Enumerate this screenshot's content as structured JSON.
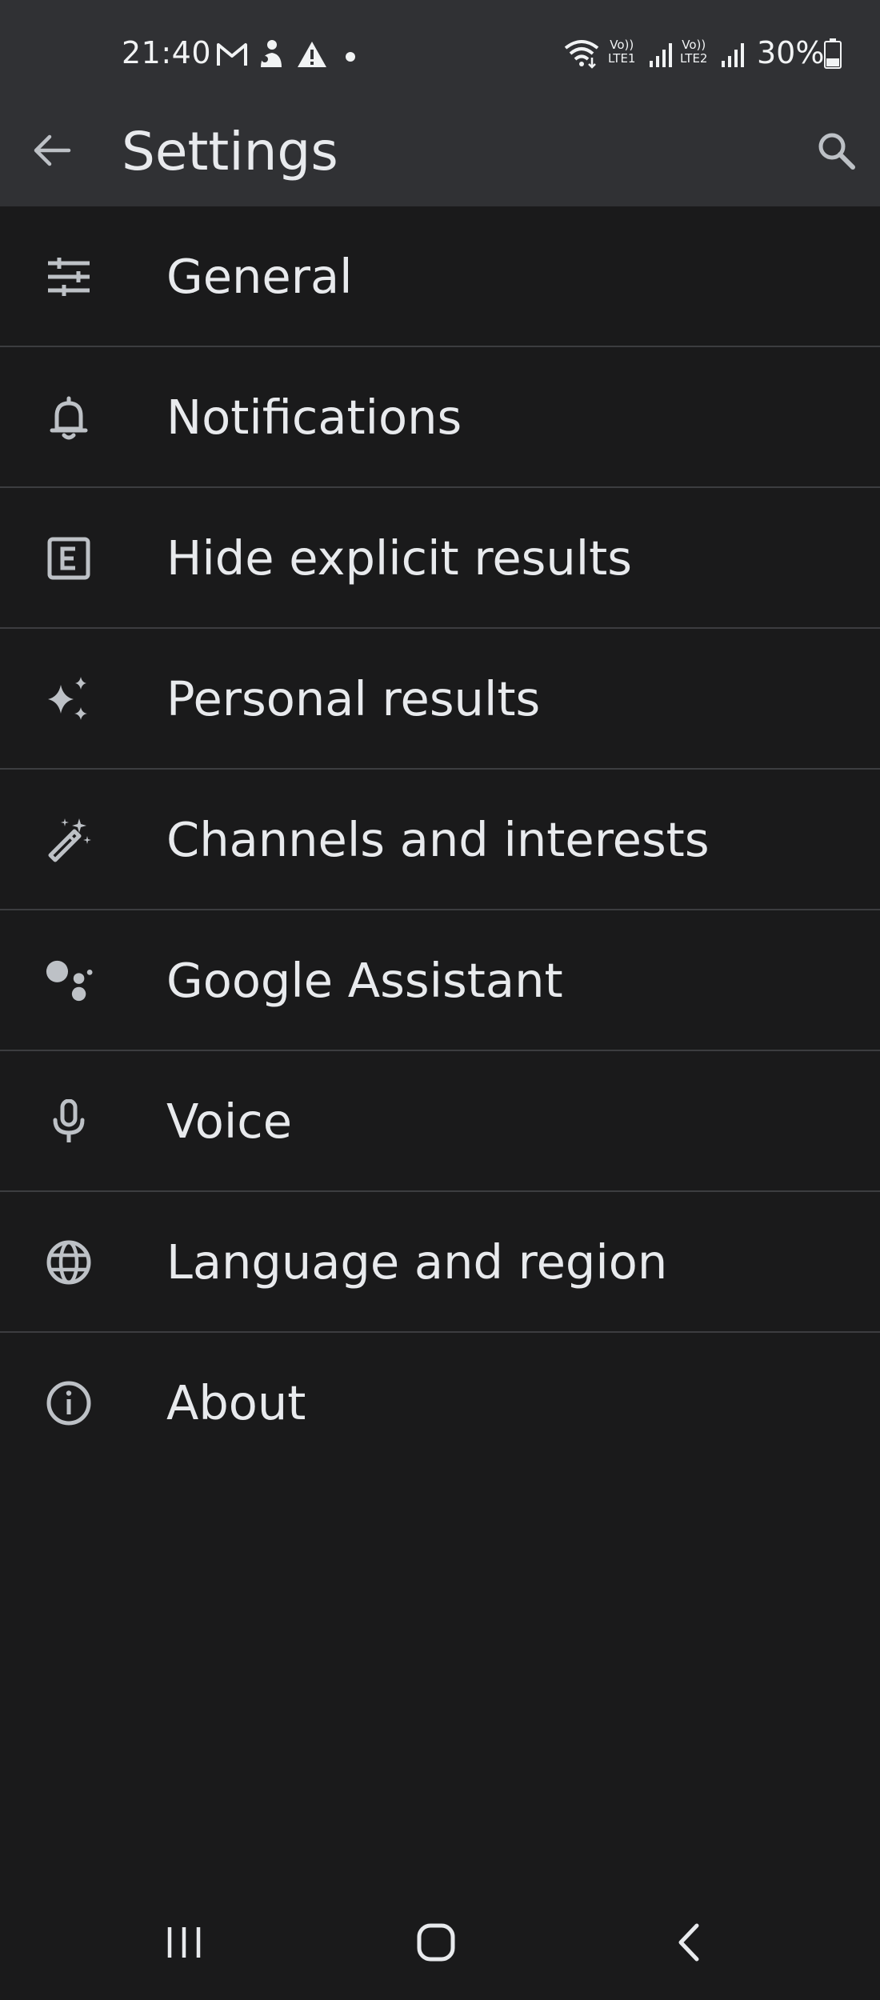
{
  "status_bar": {
    "time": "21:40",
    "battery_percent": "30%",
    "sim1_top": "Vo))",
    "sim1_bottom": "LTE1",
    "sim2_top": "Vo))",
    "sim2_bottom": "LTE2",
    "icons": [
      "gmail-icon",
      "app-notification-icon",
      "warning-icon",
      "dot-icon",
      "wifi-icon",
      "signal-icon",
      "battery-icon"
    ]
  },
  "app_bar": {
    "title": "Settings",
    "back_icon": "arrow-back-icon",
    "search_icon": "search-icon"
  },
  "settings": [
    {
      "label": "General",
      "icon": "tune-icon"
    },
    {
      "label": "Notifications",
      "icon": "bell-icon"
    },
    {
      "label": "Hide explicit results",
      "icon": "explicit-icon"
    },
    {
      "label": "Personal results",
      "icon": "sparkle-icon"
    },
    {
      "label": "Channels and interests",
      "icon": "magic-wand-icon"
    },
    {
      "label": "Google Assistant",
      "icon": "assistant-icon"
    },
    {
      "label": "Voice",
      "icon": "microphone-icon"
    },
    {
      "label": "Language and region",
      "icon": "globe-icon"
    },
    {
      "label": "About",
      "icon": "info-icon"
    }
  ],
  "nav_bar": {
    "icons": [
      "recents-icon",
      "home-icon",
      "back-icon"
    ]
  },
  "colors": {
    "background": "#1a1a1b",
    "header": "#303134",
    "text": "#e8eaed",
    "icon": "#bdc1c6",
    "divider": "#3c3d40"
  }
}
